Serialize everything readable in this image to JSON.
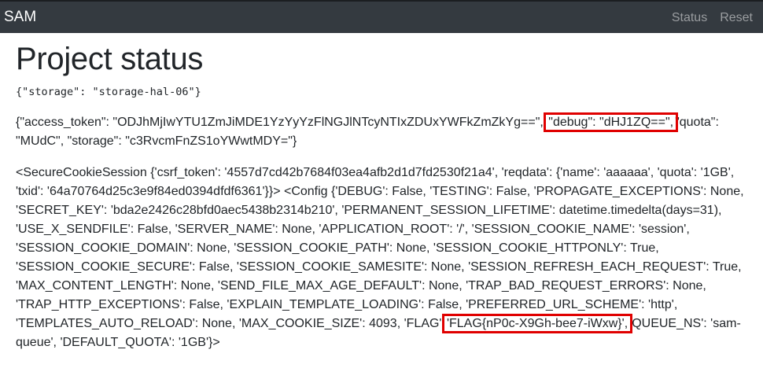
{
  "navbar": {
    "brand": "SAM",
    "links": [
      {
        "label": "Status"
      },
      {
        "label": "Reset"
      }
    ]
  },
  "page": {
    "title": "Project status",
    "storage_json": "{\"storage\": \"storage-hal-06\"}",
    "token_json": {
      "before": "{\"access_token\": \"ODJhMjIwYTU1ZmJiMDE1YzYyYzFlNGJlNTcyNTIxZDUxYWFkZmZkYg==\",",
      "highlight": "\"debug\": \"dHJ1ZQ==\",",
      "after": "\"quota\": \"MUdC\", \"storage\": \"c3RvcmFnZS1oYWwtMDY=\"}"
    },
    "session_dump": {
      "before": "<SecureCookieSession {'csrf_token': '4557d7cd42b7684f03ea4afb2d1d7fd2530f21a4', 'reqdata': {'name': 'aaaaaa', 'quota': '1GB', 'txid': '64a70764d25c3e9f84ed0394dfdf6361'}}> <Config {'DEBUG': False, 'TESTING': False, 'PROPAGATE_EXCEPTIONS': None, 'SECRET_KEY': 'bda2e2426c28bfd0aec5438b2314b210', 'PERMANENT_SESSION_LIFETIME': datetime.timedelta(days=31), 'USE_X_SENDFILE': False, 'SERVER_NAME': None, 'APPLICATION_ROOT': '/', 'SESSION_COOKIE_NAME': 'session', 'SESSION_COOKIE_DOMAIN': None, 'SESSION_COOKIE_PATH': None, 'SESSION_COOKIE_HTTPONLY': True, 'SESSION_COOKIE_SECURE': False, 'SESSION_COOKIE_SAMESITE': None, 'SESSION_REFRESH_EACH_REQUEST': True, 'MAX_CONTENT_LENGTH': None, 'SEND_FILE_MAX_AGE_DEFAULT': None, 'TRAP_BAD_REQUEST_ERRORS': None, 'TRAP_HTTP_EXCEPTIONS': False, 'EXPLAIN_TEMPLATE_LOADING': False, 'PREFERRED_URL_SCHEME': 'http', 'TEMPLATES_AUTO_RELOAD': None, 'MAX_COOKIE_SIZE': 4093, 'FLAG'",
      "highlight": "'FLAG{nP0c-X9Gh-bee7-iWxw}',",
      "after": "'QUEUE_NS': 'sam-queue', 'DEFAULT_QUOTA': '1GB'}>"
    }
  },
  "colors": {
    "navbar_bg": "#343a40",
    "highlight_border": "#e00000",
    "muted_link": "#9a9da0"
  }
}
